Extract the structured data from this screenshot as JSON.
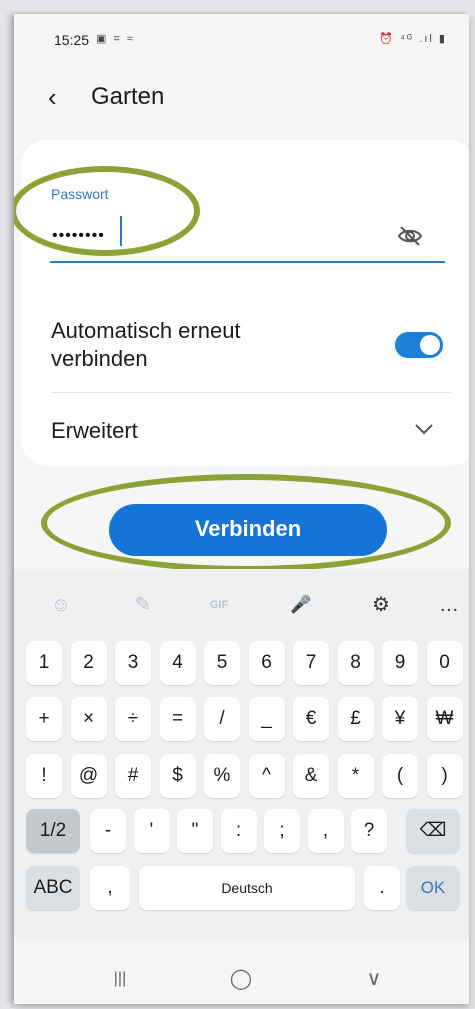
{
  "status": {
    "time": "15:25",
    "left_icons": "▣ ⌗ ≈",
    "right_icons": "⏰ ⁴ᴳ .ıl ▮"
  },
  "header": {
    "back_glyph": "‹",
    "title": "Garten"
  },
  "password": {
    "label": "Passwort",
    "value": "••••••••"
  },
  "auto_reconnect": {
    "label": "Automatisch erneut verbinden",
    "enabled": true
  },
  "advanced": {
    "label": "Erweitert"
  },
  "connect_button": "Verbinden",
  "keyboard": {
    "toolbar": [
      "☺",
      "✎",
      "GIF",
      "🎤",
      "⚙",
      "…"
    ],
    "row1": [
      "1",
      "2",
      "3",
      "4",
      "5",
      "6",
      "7",
      "8",
      "9",
      "0"
    ],
    "row2": [
      "+",
      "×",
      "÷",
      "=",
      "/",
      "_",
      "€",
      "£",
      "¥",
      "₩"
    ],
    "row3": [
      "!",
      "@",
      "#",
      "$",
      "%",
      "^",
      "&",
      "*",
      "(",
      ")"
    ],
    "row4": [
      "1/2",
      "-",
      "'",
      "\"",
      ":",
      ";",
      ",",
      "?",
      "⌫"
    ],
    "row5": {
      "abc": "ABC",
      "comma": ",",
      "space": "Deutsch",
      "period": ".",
      "ok": "OK"
    }
  },
  "navbar": {
    "recents": "|||",
    "home": "◯",
    "back": "∨"
  },
  "colors": {
    "accent": "#1674d6",
    "highlight_ellipse": "#8da236"
  }
}
